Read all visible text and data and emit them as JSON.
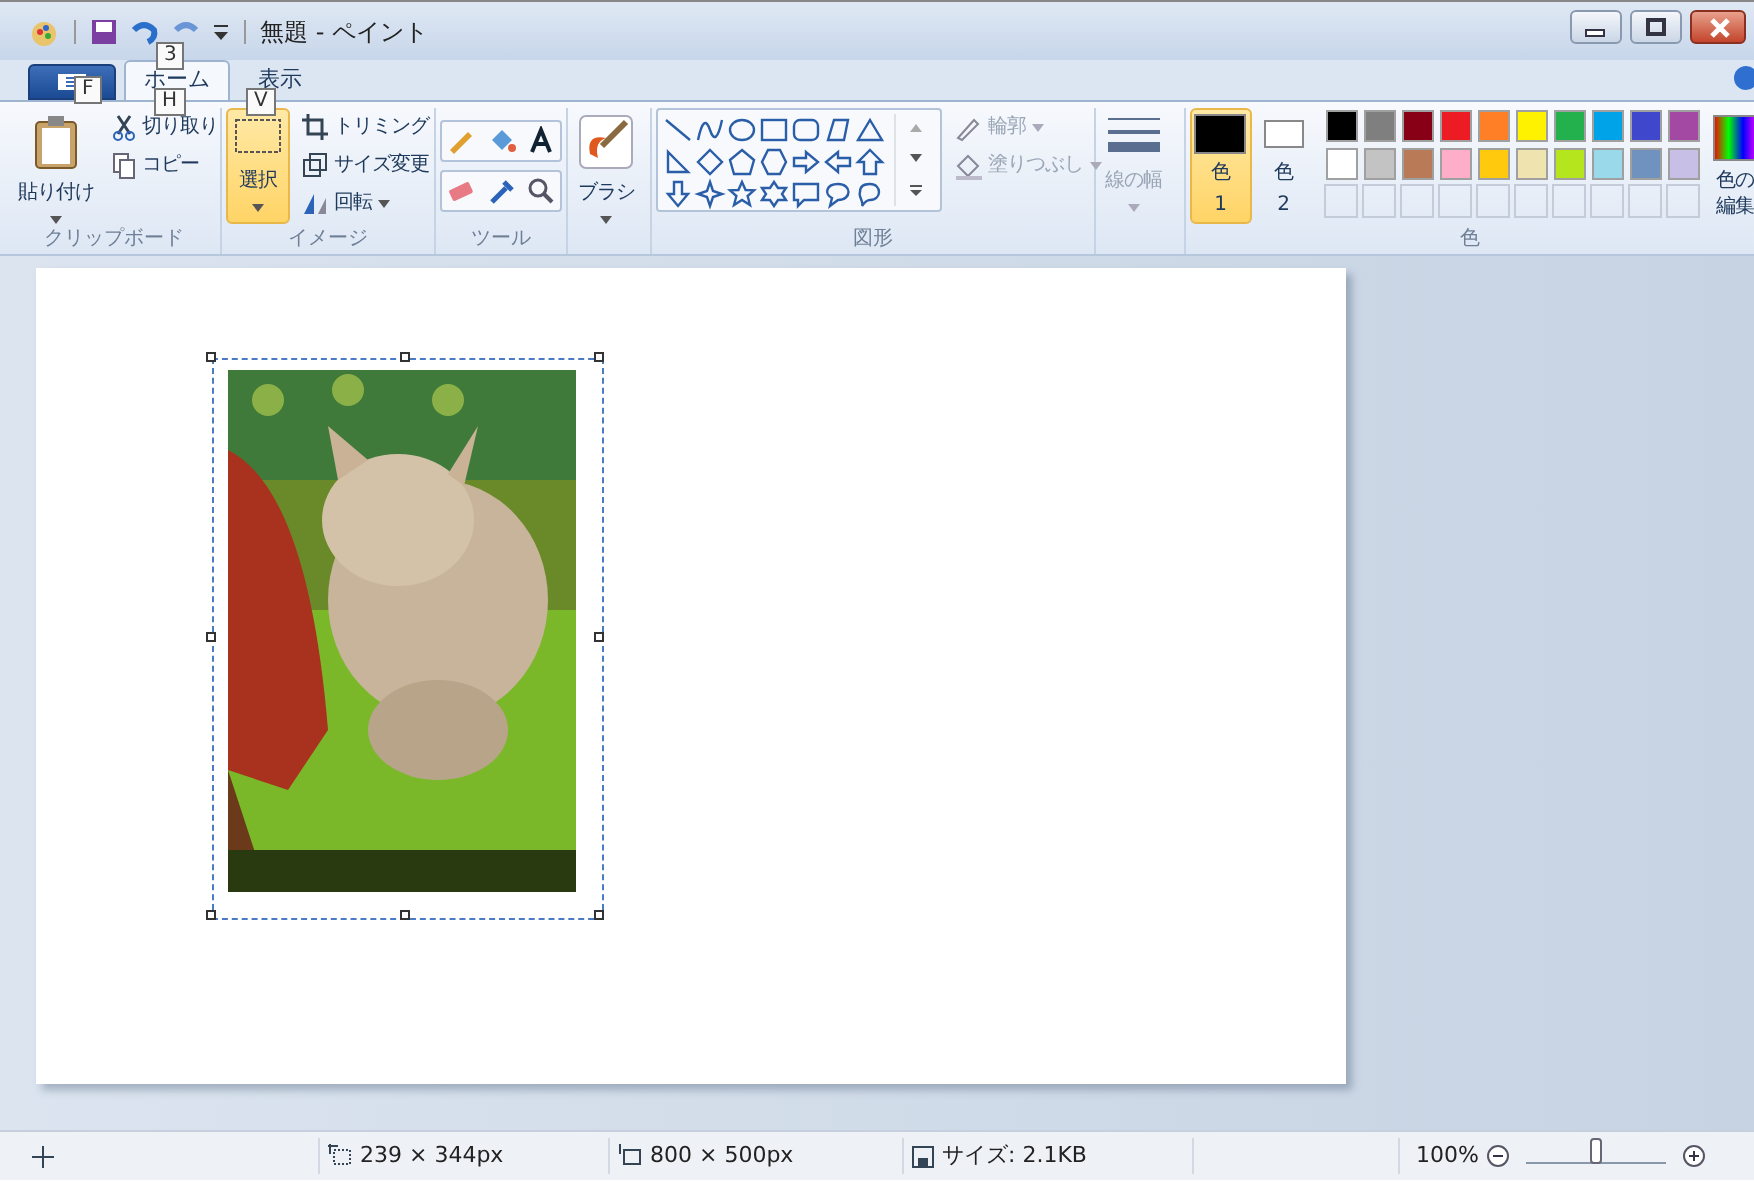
{
  "window": {
    "title": "無題 - ペイント"
  },
  "key_tips": [
    {
      "label": "3"
    },
    {
      "label": "F"
    },
    {
      "label": "H"
    },
    {
      "label": "V"
    }
  ],
  "tabs": [
    {
      "label": "ホーム",
      "selected": true
    },
    {
      "label": "表示",
      "selected": false
    }
  ],
  "clipboard": {
    "label": "クリップボード",
    "paste": "貼り付け",
    "cut": "切り取り",
    "copy": "コピー"
  },
  "image": {
    "label": "イメージ",
    "select": "選択",
    "select_active": true,
    "crop": "トリミング",
    "resize": "サイズ変更",
    "rotate": "回転"
  },
  "tools": {
    "label": "ツール"
  },
  "brush": {
    "label": "ブラシ"
  },
  "shapes": {
    "label": "図形",
    "outline": {
      "label": "輪郭",
      "disabled": true
    },
    "fill": {
      "label": "塗りつぶし",
      "disabled": true
    }
  },
  "size": {
    "label": "線の幅",
    "disabled": true
  },
  "colors": {
    "label": "色",
    "edit": "色の編集",
    "current": [
      {
        "label": "色",
        "number": "1",
        "color": "#000000",
        "selected": true
      },
      {
        "label": "色",
        "number": "2",
        "color": "#ffffff",
        "selected": false
      }
    ],
    "palette": [
      {
        "color": "#000000"
      },
      {
        "color": "#7f7f7f"
      },
      {
        "color": "#880015"
      },
      {
        "color": "#ed1c24"
      },
      {
        "color": "#ff7f27"
      },
      {
        "color": "#fff200"
      },
      {
        "color": "#22b14c"
      },
      {
        "color": "#00a2e8"
      },
      {
        "color": "#3f48cc"
      },
      {
        "color": "#a349a4"
      },
      {
        "color": "#ffffff"
      },
      {
        "color": "#c3c3c3"
      },
      {
        "color": "#b97a57"
      },
      {
        "color": "#ffaec9"
      },
      {
        "color": "#ffc90e"
      },
      {
        "color": "#efe4b0"
      },
      {
        "color": "#b5e61d"
      },
      {
        "color": "#99d9ea"
      },
      {
        "color": "#7092be"
      },
      {
        "color": "#c8bfe7"
      }
    ]
  },
  "status_bar": {
    "selection_size": "239 × 344px",
    "canvas_size": "800 × 500px",
    "file_size": "サイズ: 2.1KB",
    "zoom": "100%",
    "zoom_slider": {
      "level": 0.5
    }
  }
}
